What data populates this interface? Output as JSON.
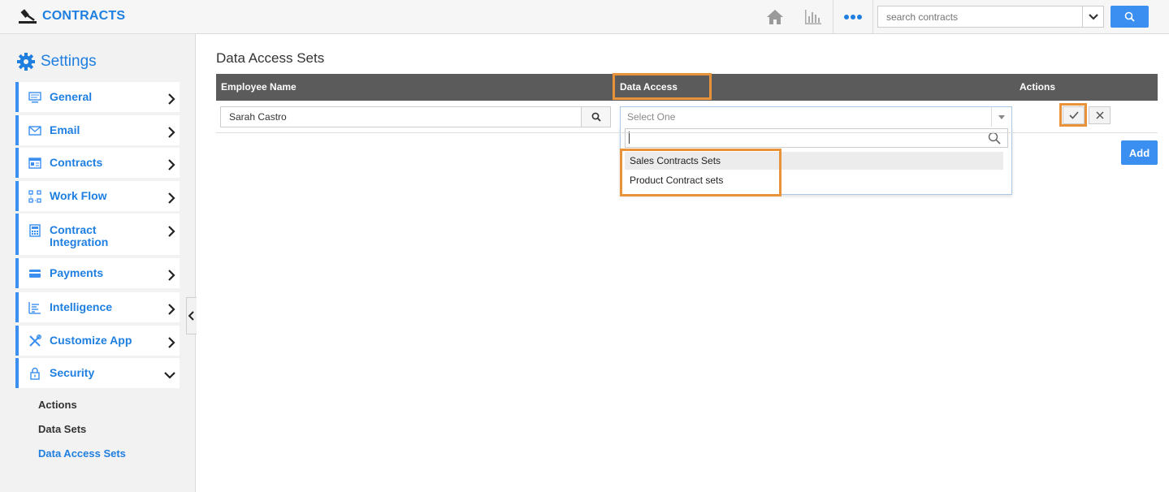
{
  "app": {
    "title": "CONTRACTS",
    "brand_color": "#1f7fe0"
  },
  "topbar": {
    "icons": [
      "home-icon",
      "reports-icon",
      "more-icon"
    ],
    "search": {
      "placeholder": "search contracts",
      "value": ""
    }
  },
  "sidebar": {
    "heading": "Settings",
    "items": [
      {
        "label": "General",
        "icon": "monitor-icon",
        "expanded": false
      },
      {
        "label": "Email",
        "icon": "envelope-icon",
        "expanded": false
      },
      {
        "label": "Contracts",
        "icon": "contract-icon",
        "expanded": false
      },
      {
        "label": "Work Flow",
        "icon": "workflow-icon",
        "expanded": false
      },
      {
        "label": "Contract Integration",
        "icon": "integration-icon",
        "expanded": false
      },
      {
        "label": "Payments",
        "icon": "card-icon",
        "expanded": false
      },
      {
        "label": "Intelligence",
        "icon": "chart-icon",
        "expanded": false
      },
      {
        "label": "Customize App",
        "icon": "tools-icon",
        "expanded": false
      },
      {
        "label": "Security",
        "icon": "lock-icon",
        "expanded": true
      }
    ],
    "sub_items": [
      {
        "label": "Actions",
        "active": false
      },
      {
        "label": "Data Sets",
        "active": false
      },
      {
        "label": "Data Access Sets",
        "active": true
      }
    ]
  },
  "main": {
    "title": "Data Access Sets",
    "columns": [
      "Employee Name",
      "Data Access",
      "Actions"
    ],
    "row": {
      "employee": "Sarah Castro",
      "data_access_placeholder": "Select One"
    },
    "dropdown": {
      "search_value": "",
      "options": [
        "Sales Contracts Sets",
        "Product Contract sets"
      ],
      "hovered_index": 0
    },
    "add_label": "Add"
  },
  "colors": {
    "accent": "#3b8ff0",
    "header_bg": "#5b5b5b",
    "highlight": "#e8923a"
  }
}
